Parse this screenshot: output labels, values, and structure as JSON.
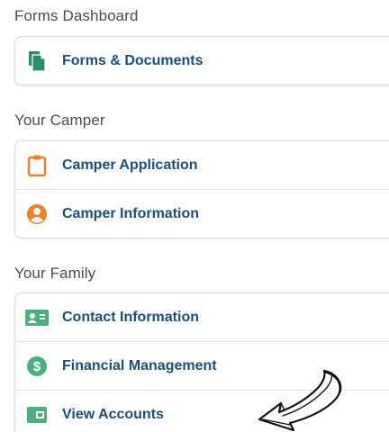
{
  "header": {
    "title": "Forms Dashboard"
  },
  "forms": {
    "items": [
      {
        "label": "Forms & Documents",
        "icon": "documents-icon",
        "color": "#2e8b6f"
      }
    ]
  },
  "camper": {
    "title": "Your Camper",
    "items": [
      {
        "label": "Camper Application",
        "icon": "clipboard-icon",
        "color": "#f07f2a"
      },
      {
        "label": "Camper Information",
        "icon": "person-icon",
        "color": "#f07f2a"
      }
    ]
  },
  "family": {
    "title": "Your Family",
    "items": [
      {
        "label": "Contact Information",
        "icon": "contact-card-icon",
        "color": "#4caf7d"
      },
      {
        "label": "Financial Management",
        "icon": "dollar-icon",
        "color": "#4caf7d"
      },
      {
        "label": "View Accounts",
        "icon": "wallet-icon",
        "color": "#4caf7d"
      }
    ]
  },
  "colors": {
    "link": "#1f4e79",
    "section_title": "#4d4d4d",
    "border": "#d9d9d9"
  }
}
